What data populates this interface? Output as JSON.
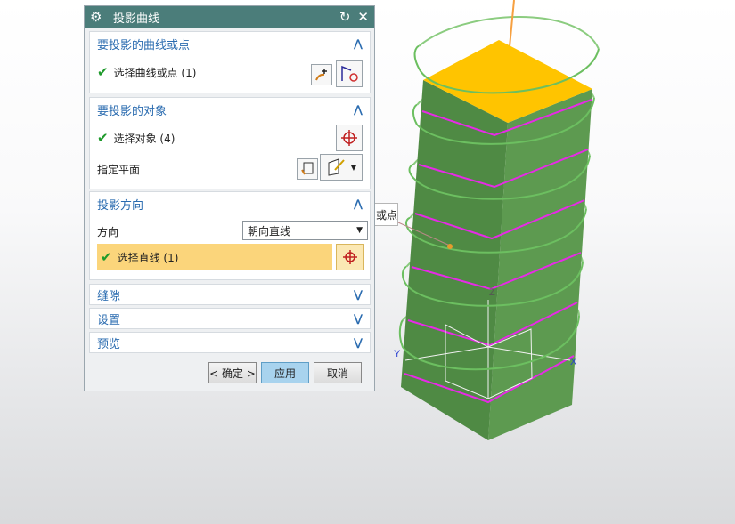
{
  "dialog": {
    "title": "投影曲线",
    "sections": {
      "curves": {
        "header": "要投影的曲线或点",
        "select_label": "选择曲线或点 (1)"
      },
      "objects": {
        "header": "要投影的对象",
        "select_label": "选择对象 (4)",
        "plane_label": "指定平面"
      },
      "direction": {
        "header": "投影方向",
        "direction_label": "方向",
        "direction_value": "朝向直线",
        "select_line_label": "选择直线 (1)"
      },
      "gap": {
        "header": "缝隙"
      },
      "settings": {
        "header": "设置"
      },
      "preview": {
        "header": "预览"
      }
    },
    "buttons": {
      "ok": "< 确定 >",
      "apply": "应用",
      "cancel": "取消"
    }
  },
  "viewport": {
    "tooltip_text": "或点",
    "axis_labels": {
      "z": "Z",
      "y": "Y",
      "x": "X"
    },
    "colors": {
      "body": "#57914a",
      "top_face": "#ffc400",
      "helix": "#6cbf60",
      "projected_curve": "#e62ae6",
      "line": "#f6a040"
    }
  }
}
